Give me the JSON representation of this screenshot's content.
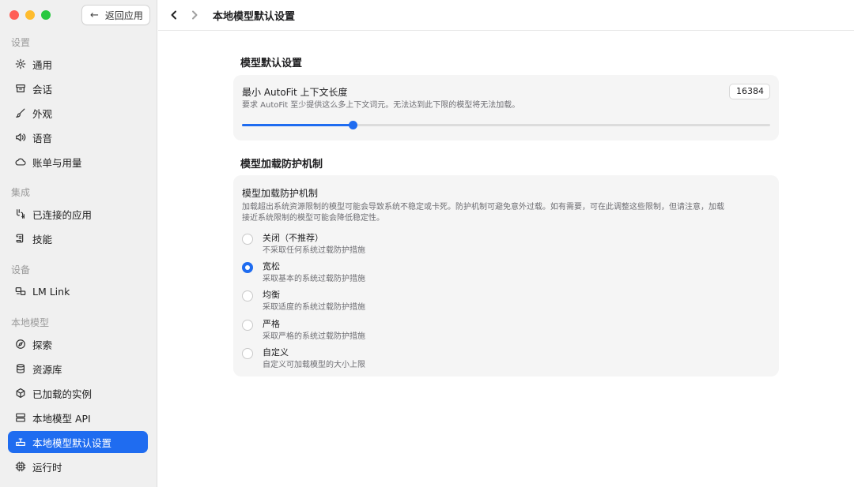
{
  "window": {
    "traffic_colors": [
      "#ff5f57",
      "#febc2e",
      "#28c840"
    ],
    "back_label": "返回应用"
  },
  "sidebar": {
    "sections": [
      {
        "title": "设置",
        "items": [
          {
            "label": "通用",
            "icon": "gear-icon"
          },
          {
            "label": "会话",
            "icon": "archive-icon"
          },
          {
            "label": "外观",
            "icon": "brush-icon"
          },
          {
            "label": "语音",
            "icon": "speaker-icon"
          },
          {
            "label": "账单与用量",
            "icon": "cloud-icon"
          }
        ]
      },
      {
        "title": "集成",
        "items": [
          {
            "label": "已连接的应用",
            "icon": "connected-apps-icon"
          },
          {
            "label": "技能",
            "icon": "scroll-icon"
          }
        ]
      },
      {
        "title": "设备",
        "items": [
          {
            "label": "LM Link",
            "icon": "devices-icon"
          }
        ]
      },
      {
        "title": "本地模型",
        "items": [
          {
            "label": "探索",
            "icon": "compass-icon"
          },
          {
            "label": "资源库",
            "icon": "database-icon"
          },
          {
            "label": "已加载的实例",
            "icon": "cube-icon"
          },
          {
            "label": "本地模型 API",
            "icon": "server-icon"
          },
          {
            "label": "本地模型默认设置",
            "icon": "model-defaults-icon",
            "active": true
          },
          {
            "label": "运行时",
            "icon": "chip-icon"
          }
        ]
      }
    ]
  },
  "header": {
    "title": "本地模型默认设置"
  },
  "main": {
    "section1_title": "模型默认设置",
    "autofit": {
      "title": "最小 AutoFit 上下文长度",
      "desc": "要求 AutoFit 至少提供这么多上下文词元。无法达到此下限的模型将无法加载。",
      "value": "16384",
      "slider_fraction": 0.21
    },
    "section2_title": "模型加载防护机制",
    "guard": {
      "title": "模型加载防护机制",
      "desc_line1": "加载超出系统资源限制的模型可能会导致系统不稳定或卡死。防护机制可避免意外过载。如有需要，可在此调整这些限制，但请注意，加载",
      "desc_line2": "接近系统限制的模型可能会降低稳定性。",
      "options": [
        {
          "label": "关闭（不推荐）",
          "sub": "不采取任何系统过载防护措施",
          "selected": false
        },
        {
          "label": "宽松",
          "sub": "采取基本的系统过载防护措施",
          "selected": true
        },
        {
          "label": "均衡",
          "sub": "采取适度的系统过载防护措施",
          "selected": false
        },
        {
          "label": "严格",
          "sub": "采取严格的系统过载防护措施",
          "selected": false
        },
        {
          "label": "自定义",
          "sub": "自定义可加载模型的大小上限",
          "selected": false
        }
      ]
    },
    "accent_color": "#1f6cf0"
  }
}
